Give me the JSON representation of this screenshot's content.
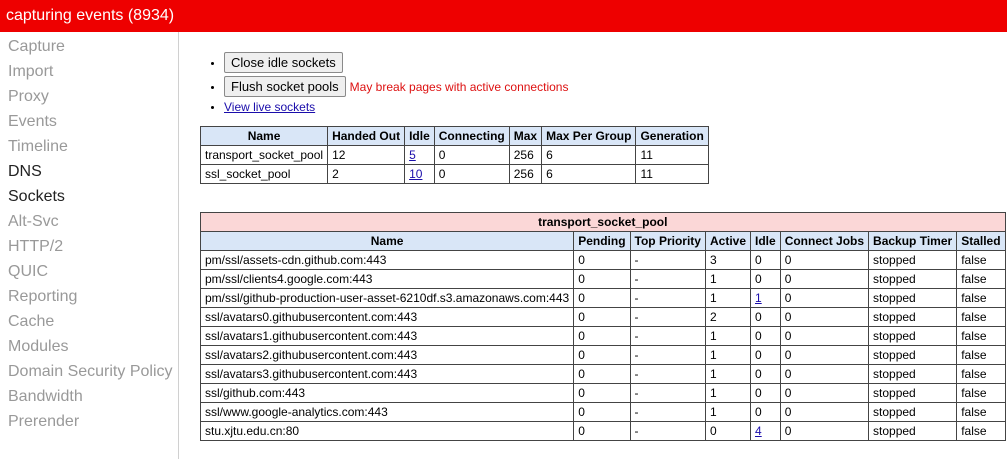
{
  "title": "capturing events (8934)",
  "sidebar": {
    "items": [
      {
        "label": "Capture",
        "dark": false
      },
      {
        "label": "Import",
        "dark": false
      },
      {
        "label": "Proxy",
        "dark": false
      },
      {
        "label": "Events",
        "dark": false
      },
      {
        "label": "Timeline",
        "dark": false
      },
      {
        "label": "DNS",
        "dark": true
      },
      {
        "label": "Sockets",
        "dark": true
      },
      {
        "label": "Alt-Svc",
        "dark": false
      },
      {
        "label": "HTTP/2",
        "dark": false
      },
      {
        "label": "QUIC",
        "dark": false
      },
      {
        "label": "Reporting",
        "dark": false
      },
      {
        "label": "Cache",
        "dark": false
      },
      {
        "label": "Modules",
        "dark": false
      },
      {
        "label": "Domain Security Policy",
        "dark": false
      },
      {
        "label": "Bandwidth",
        "dark": false
      },
      {
        "label": "Prerender",
        "dark": false
      }
    ]
  },
  "actions": {
    "close_idle": "Close idle sockets",
    "flush": "Flush socket pools",
    "flush_warning": "May break pages with active connections",
    "view_live": "View live sockets"
  },
  "pools_table": {
    "headers": [
      "Name",
      "Handed Out",
      "Idle",
      "Connecting",
      "Max",
      "Max Per Group",
      "Generation"
    ],
    "rows": [
      [
        "transport_socket_pool",
        "12",
        "5",
        "0",
        "256",
        "6",
        "11"
      ],
      [
        "ssl_socket_pool",
        "2",
        "10",
        "0",
        "256",
        "6",
        "11"
      ]
    ]
  },
  "group_table": {
    "caption": "transport_socket_pool",
    "headers": [
      "Name",
      "Pending",
      "Top Priority",
      "Active",
      "Idle",
      "Connect Jobs",
      "Backup Timer",
      "Stalled"
    ],
    "rows": [
      [
        "pm/ssl/assets-cdn.github.com:443",
        "0",
        "-",
        "3",
        "0",
        "0",
        "stopped",
        "false"
      ],
      [
        "pm/ssl/clients4.google.com:443",
        "0",
        "-",
        "1",
        "0",
        "0",
        "stopped",
        "false"
      ],
      [
        "pm/ssl/github-production-user-asset-6210df.s3.amazonaws.com:443",
        "0",
        "-",
        "1",
        "1",
        "0",
        "stopped",
        "false"
      ],
      [
        "ssl/avatars0.githubusercontent.com:443",
        "0",
        "-",
        "2",
        "0",
        "0",
        "stopped",
        "false"
      ],
      [
        "ssl/avatars1.githubusercontent.com:443",
        "0",
        "-",
        "1",
        "0",
        "0",
        "stopped",
        "false"
      ],
      [
        "ssl/avatars2.githubusercontent.com:443",
        "0",
        "-",
        "1",
        "0",
        "0",
        "stopped",
        "false"
      ],
      [
        "ssl/avatars3.githubusercontent.com:443",
        "0",
        "-",
        "1",
        "0",
        "0",
        "stopped",
        "false"
      ],
      [
        "ssl/github.com:443",
        "0",
        "-",
        "1",
        "0",
        "0",
        "stopped",
        "false"
      ],
      [
        "ssl/www.google-analytics.com:443",
        "0",
        "-",
        "1",
        "0",
        "0",
        "stopped",
        "false"
      ],
      [
        "stu.xjtu.edu.cn:80",
        "0",
        "-",
        "0",
        "4",
        "0",
        "stopped",
        "false"
      ]
    ],
    "idle_links": [
      false,
      false,
      true,
      false,
      false,
      false,
      false,
      false,
      false,
      true
    ]
  },
  "colors": {
    "titlebar": "#ee0000",
    "header_bg": "#d9e6f7",
    "caption_bg": "#fbd7d7",
    "warning": "#dd1111"
  }
}
